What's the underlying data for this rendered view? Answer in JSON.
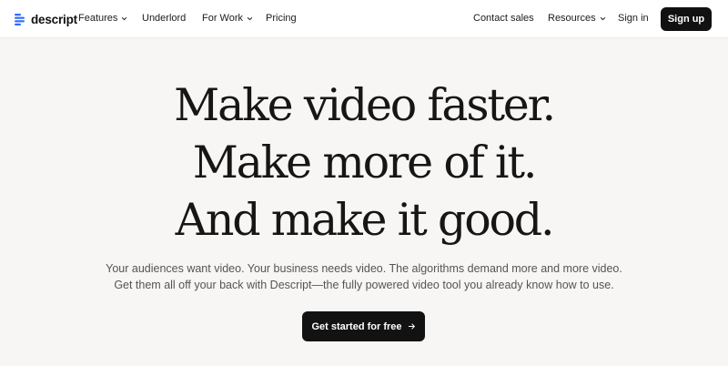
{
  "nav": {
    "logo_text": "descript",
    "features": "Features",
    "underlord": "Underlord",
    "for_work": "For Work",
    "pricing": "Pricing",
    "contact_sales": "Contact sales",
    "resources": "Resources",
    "sign_in": "Sign in",
    "sign_up": "Sign up"
  },
  "hero": {
    "headline_line1": "Make video faster.",
    "headline_line2": "Make more of it.",
    "headline_line3": "And make it good.",
    "subtext": "Your audiences want video. Your business needs video. The algorithms demand more and more video. Get them all off your back with Descript—the fully powered video tool you already know how to use.",
    "cta_label": "Get started for free"
  },
  "colors": {
    "page_background": "#f7f6f4",
    "nav_background": "#ffffff",
    "primary_button": "#111111",
    "logo_accent": "#2f6bff"
  },
  "icons": {
    "logo": "descript-logo-icon",
    "dropdown": "chevron-down-icon",
    "cta": "arrow-right-icon"
  }
}
